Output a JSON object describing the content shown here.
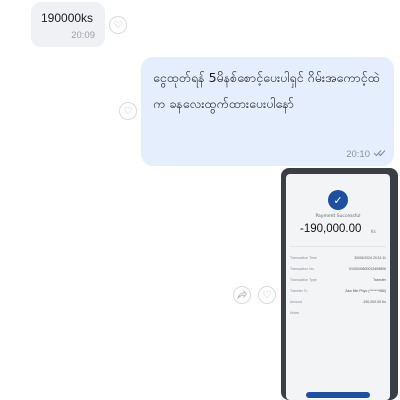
{
  "incoming": {
    "text": "190000ks",
    "time": "20:09"
  },
  "outgoing": {
    "text": "ငွေထုတ်ရန် 5မိနစ်စောင့်ပေးပါရှင် ဂိမ်းအကောင့်ထဲက ခနလေးထွက်ထားပေးပါနော်",
    "time": "20:10",
    "status_icon": "double-check-icon"
  },
  "image_message": {
    "payment_status": "Payment Successful",
    "amount": "-190,000.00",
    "currency": "Ks",
    "rows": [
      {
        "label": "Transaction Time",
        "value": "30/06/2024 20:11:11"
      },
      {
        "label": "Transaction No.",
        "value": "0100340600013409806"
      },
      {
        "label": "Transaction Type",
        "value": "Transfer"
      },
      {
        "label": "Transfer To",
        "value": "Zaw Min Phyo (*******986)"
      },
      {
        "label": "Amount",
        "value": "-190,000.00 Ks"
      },
      {
        "label": "Notes",
        "value": ""
      }
    ]
  },
  "colors": {
    "incoming_bubble": "#eff1f4",
    "outgoing_bubble": "#e5eefd",
    "accent": "#1d4fa3"
  }
}
